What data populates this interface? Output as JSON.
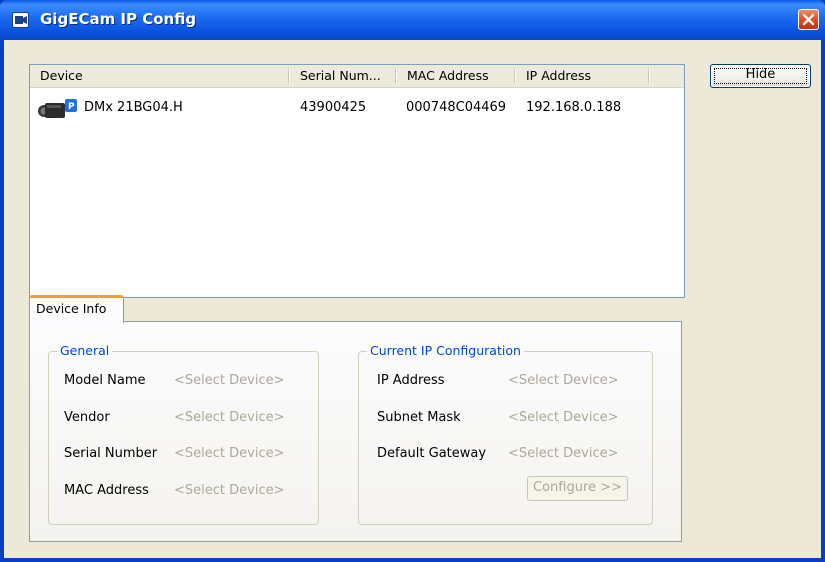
{
  "window": {
    "title": "GigECam IP Config"
  },
  "device_list": {
    "columns": [
      "Device",
      "Serial Num...",
      "MAC Address",
      "IP Address"
    ],
    "rows": [
      {
        "device": "DMx 21BG04.H",
        "serial": "43900425",
        "mac": "000748C04469",
        "ip": "192.168.0.188",
        "icon": "camera-icon"
      }
    ]
  },
  "buttons": {
    "hide": "Hide",
    "configure": "Configure >>"
  },
  "tabs": [
    {
      "label": "Device Info",
      "selected": true
    }
  ],
  "general": {
    "title": "General",
    "fields": [
      {
        "label": "Model Name",
        "value": "<Select Device>"
      },
      {
        "label": "Vendor",
        "value": "<Select Device>"
      },
      {
        "label": "Serial Number",
        "value": "<Select Device>"
      },
      {
        "label": "MAC Address",
        "value": "<Select Device>"
      }
    ]
  },
  "ip_config": {
    "title": "Current IP Configuration",
    "fields": [
      {
        "label": "IP Address",
        "value": "<Select Device>"
      },
      {
        "label": "Subnet Mask",
        "value": "<Select Device>"
      },
      {
        "label": "Default Gateway",
        "value": "<Select Device>"
      }
    ]
  },
  "colors": {
    "titlebar": "#0a5ce8",
    "group_title": "#0046d5",
    "disabled_text": "#aca899",
    "tab_highlight": "#f0a22e",
    "close_button": "#e0481c"
  }
}
